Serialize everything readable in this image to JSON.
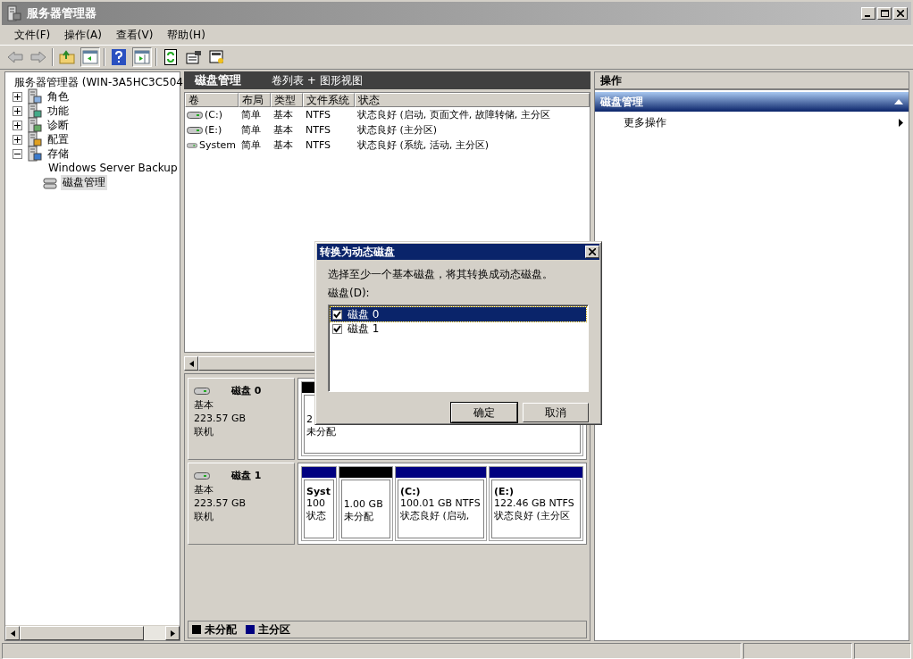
{
  "window": {
    "title": "服务器管理器"
  },
  "menu": [
    "文件(F)",
    "操作(A)",
    "查看(V)",
    "帮助(H)"
  ],
  "tree": {
    "root": "服务器管理器 (WIN-3A5HC3C504",
    "items": [
      {
        "label": "角色",
        "expanded": false,
        "selected": false
      },
      {
        "label": "功能",
        "expanded": false,
        "selected": false
      },
      {
        "label": "诊断",
        "expanded": false,
        "selected": false
      },
      {
        "label": "配置",
        "expanded": false,
        "selected": false
      },
      {
        "label": "存储",
        "expanded": true,
        "selected": false,
        "children": [
          {
            "label": "Windows Server Backup",
            "selected": false
          },
          {
            "label": "磁盘管理",
            "selected": true
          }
        ]
      }
    ]
  },
  "center": {
    "title": "磁盘管理",
    "view": "卷列表 + 图形视图",
    "columns": [
      "卷",
      "布局",
      "类型",
      "文件系统",
      "状态"
    ],
    "rows": [
      {
        "volume": "(C:)",
        "layout": "简单",
        "type": "基本",
        "file_system": "NTFS",
        "status": "状态良好 (启动, 页面文件, 故障转储, 主分区"
      },
      {
        "volume": "(E:)",
        "layout": "简单",
        "type": "基本",
        "file_system": "NTFS",
        "status": "状态良好 (主分区)"
      },
      {
        "volume": "System",
        "layout": "简单",
        "type": "基本",
        "file_system": "NTFS",
        "status": "状态良好 (系统, 活动, 主分区)"
      }
    ],
    "disks": [
      {
        "name": "磁盘 0",
        "type": "基本",
        "size": "223.57 GB",
        "status": "联机",
        "partitions": [
          {
            "kind": "unallocated",
            "lines": [
              "2",
              "未分配"
            ]
          }
        ]
      },
      {
        "name": "磁盘 1",
        "type": "基本",
        "size": "223.57 GB",
        "status": "联机",
        "partitions": [
          {
            "kind": "primary",
            "title": "Syst",
            "lines": [
              "100",
              "状态"
            ]
          },
          {
            "kind": "unallocated",
            "lines": [
              "1.00 GB",
              "未分配"
            ]
          },
          {
            "kind": "primary",
            "title": "(C:)",
            "lines": [
              "100.01 GB NTFS",
              "状态良好 (启动,"
            ]
          },
          {
            "kind": "primary",
            "title": "(E:)",
            "lines": [
              "122.46 GB NTFS",
              "状态良好 (主分区"
            ]
          }
        ]
      }
    ],
    "legend": [
      {
        "kind": "unallocated",
        "label": "未分配"
      },
      {
        "kind": "primary",
        "label": "主分区"
      }
    ]
  },
  "actions": {
    "title": "操作",
    "section": "磁盘管理",
    "expanded": true,
    "items": [
      "更多操作"
    ]
  },
  "dialog": {
    "title": "转换为动态磁盘",
    "prompt": "选择至少一个基本磁盘，将其转换成动态磁盘。",
    "list_label": "磁盘(D):",
    "items": [
      {
        "label": "磁盘 0",
        "checked": true,
        "selected": true
      },
      {
        "label": "磁盘 1",
        "checked": true,
        "selected": false
      }
    ],
    "buttons": [
      "确定",
      "取消"
    ]
  }
}
